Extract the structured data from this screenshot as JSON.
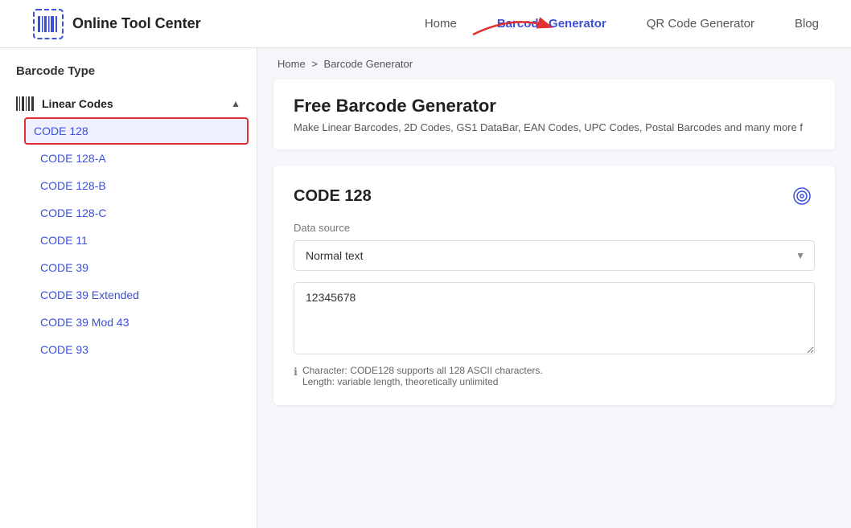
{
  "header": {
    "logo_text": "Online Tool Center",
    "nav": [
      {
        "id": "home",
        "label": "Home",
        "active": false
      },
      {
        "id": "barcode-generator",
        "label": "Barcode Generator",
        "active": true
      },
      {
        "id": "qr-code-generator",
        "label": "QR Code Generator",
        "active": false
      },
      {
        "id": "blog",
        "label": "Blog",
        "active": false
      }
    ]
  },
  "sidebar": {
    "title": "Barcode Type",
    "sections": [
      {
        "id": "linear-codes",
        "label": "Linear Codes",
        "expanded": true,
        "items": [
          {
            "id": "code-128",
            "label": "CODE 128",
            "selected": true
          },
          {
            "id": "code-128-a",
            "label": "CODE 128-A",
            "selected": false
          },
          {
            "id": "code-128-b",
            "label": "CODE 128-B",
            "selected": false
          },
          {
            "id": "code-128-c",
            "label": "CODE 128-C",
            "selected": false
          },
          {
            "id": "code-11",
            "label": "CODE 11",
            "selected": false
          },
          {
            "id": "code-39",
            "label": "CODE 39",
            "selected": false
          },
          {
            "id": "code-39-extended",
            "label": "CODE 39 Extended",
            "selected": false
          },
          {
            "id": "code-39-mod-43",
            "label": "CODE 39 Mod 43",
            "selected": false
          },
          {
            "id": "code-93",
            "label": "CODE 93",
            "selected": false
          }
        ]
      }
    ]
  },
  "breadcrumb": {
    "items": [
      "Home",
      "Barcode Generator"
    ]
  },
  "main": {
    "page_title": "Free Barcode Generator",
    "page_subtitle": "Make Linear Barcodes, 2D Codes, GS1 DataBar, EAN Codes, UPC Codes, Postal Barcodes and many more f",
    "generator": {
      "title": "CODE 128",
      "data_source_label": "Data source",
      "data_source_options": [
        "Normal text"
      ],
      "data_source_selected": "Normal text",
      "textarea_value": "12345678",
      "info_line1": "Character: CODE128 supports all 128 ASCII characters.",
      "info_line2": "Length: variable length, theoretically unlimited"
    }
  }
}
